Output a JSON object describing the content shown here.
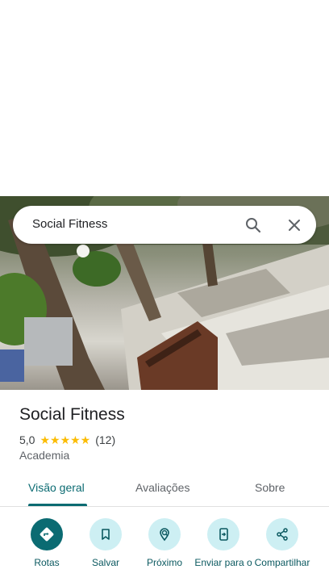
{
  "search": {
    "query": "Social Fitness"
  },
  "place": {
    "title": "Social Fitness",
    "rating": "5,0",
    "stars": "★★★★★",
    "reviews": "(12)",
    "category": "Academia"
  },
  "tabs": [
    {
      "label": "Visão geral",
      "active": true
    },
    {
      "label": "Avaliações",
      "active": false
    },
    {
      "label": "Sobre",
      "active": false
    }
  ],
  "actions": [
    {
      "label": "Rotas",
      "icon": "directions-icon"
    },
    {
      "label": "Salvar",
      "icon": "bookmark-icon"
    },
    {
      "label": "Próximo",
      "icon": "nearby-icon"
    },
    {
      "label": "Enviar para o",
      "icon": "send-to-phone-icon"
    },
    {
      "label": "Compartilhar",
      "icon": "share-icon"
    }
  ],
  "colors": {
    "accent": "#0b6b72",
    "accent_light": "#cdeff3",
    "star": "#fbbc04"
  }
}
